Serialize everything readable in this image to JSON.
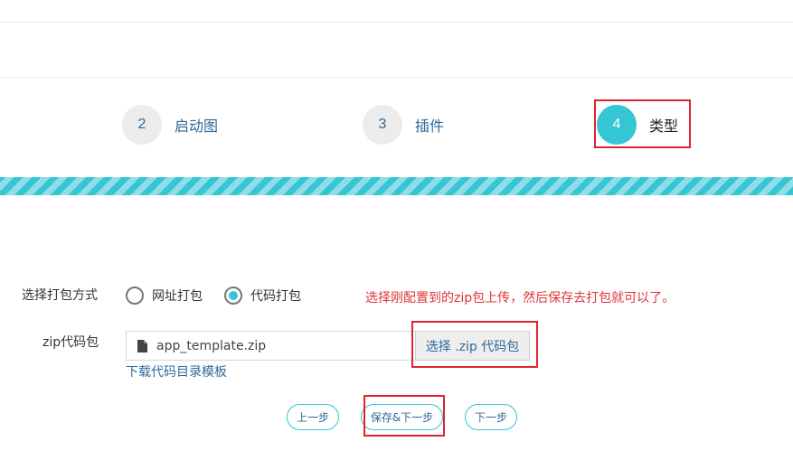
{
  "steps": [
    {
      "number": "2",
      "label": "启动图",
      "active": false
    },
    {
      "number": "3",
      "label": "插件",
      "active": false
    },
    {
      "number": "4",
      "label": "类型",
      "active": true
    }
  ],
  "form": {
    "pack_method_label": "选择打包方式",
    "options": [
      {
        "label": "网址打包",
        "checked": false
      },
      {
        "label": "代码打包",
        "checked": true
      }
    ],
    "note": "选择刚配置到的zip包上传，然后保存去打包就可以了。",
    "zip_label": "zip代码包",
    "file_name": "app_template.zip",
    "choose_button": "选择 .zip 代码包",
    "download_link": "下载代码目录模板"
  },
  "buttons": {
    "prev": "上一步",
    "save_next": "保存&下一步",
    "next": "下一步"
  },
  "colors": {
    "accent": "#35c6d3",
    "link": "#2f6a9a",
    "highlight_box": "#d9262c",
    "note_text": "#e0333a"
  },
  "icons": [
    "document-icon"
  ]
}
